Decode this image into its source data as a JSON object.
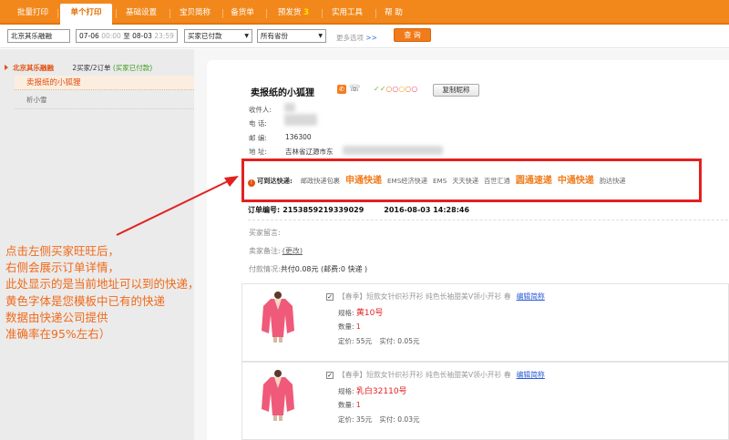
{
  "nav": {
    "tabs": [
      {
        "label": "批量打印"
      },
      {
        "label": "单个打印"
      },
      {
        "label": "基础设置"
      },
      {
        "label": "宝贝简称"
      },
      {
        "label": "备货单"
      },
      {
        "label": "预发货",
        "badge": "3"
      },
      {
        "label": "实用工具"
      },
      {
        "label": "帮 助"
      }
    ],
    "active_tab": "单个打印",
    "accent_color": "#f2881c"
  },
  "filter": {
    "shop": "北京其乐融融",
    "date_from": "07-06",
    "time_from": "00:00",
    "to_label": "至",
    "date_to": "08-03",
    "time_to": "23:59",
    "status": "买家已付款",
    "province": "所有省份",
    "more_options": "更多选项",
    "more_arrow": ">>",
    "query_button": "查 询"
  },
  "sidebar": {
    "shop_name": "北京其乐融融",
    "count": "2买家/2订单",
    "paid": "(买家已付款)",
    "buyers": [
      "卖报纸的小狐狸",
      "析小雪"
    ]
  },
  "detail": {
    "seller_name": "卖报纸的小狐狸",
    "credit_check": "✓✓",
    "copy_nick_button": "复制昵称",
    "receiver_label": "收件人:",
    "phone_label": "电  话:",
    "zip_label": "邮  编:",
    "zip": "136300",
    "address_label": "地  址:",
    "address": "吉林省辽源市东",
    "express": {
      "label": "可到达快递:",
      "items": [
        {
          "name": "邮政快递包裹",
          "highlight": false
        },
        {
          "name": "申通快递",
          "highlight": true
        },
        {
          "name": "EMS经济快递",
          "highlight": false
        },
        {
          "name": "EMS",
          "highlight": false
        },
        {
          "name": "天天快递",
          "highlight": false
        },
        {
          "name": "百世汇通",
          "highlight": false
        },
        {
          "name": "圆通速递",
          "highlight": true
        },
        {
          "name": "中通快递",
          "highlight": true
        },
        {
          "name": "韵达快递",
          "highlight": false
        }
      ]
    },
    "order_label": "订单编号:",
    "order_no": "2153859219339029",
    "order_time": "2016-08-03 14:28:46",
    "buyer_msg_label": "买家留言:",
    "seller_note_label": "卖家备注:",
    "seller_note_link": "(更改)",
    "pay_label": "付款情况:",
    "pay_value": "共付0.08元 (邮费:0 快递 )",
    "products": [
      {
        "title": "【春季】短款女针织衫开衫 纯色长袖甜美V领小开衫 春",
        "edit": "编辑简称",
        "spec_label": "规格:",
        "spec": "黄10号",
        "qty_label": "数量:",
        "qty": "1",
        "price_label": "定价:",
        "price": "55元",
        "paid_label": "实付:",
        "paid": "0.05元"
      },
      {
        "title": "【春季】短款女针织衫开衫 纯色长袖甜美V领小开衫 春",
        "edit": "编辑简称",
        "spec_label": "规格:",
        "spec": "乳白32110号",
        "qty_label": "数量:",
        "qty": "1",
        "price_label": "定价:",
        "price": "35元",
        "paid_label": "实付:",
        "paid": "0.03元"
      }
    ]
  },
  "annotation": [
    "点击左侧买家旺旺后，",
    "右侧会展示订单详情，",
    "此处显示的是当前地址可以到的快递，",
    "黄色字体是您模板中已有的快递",
    "数据由快递公司提供",
    "准确率在95%左右）"
  ],
  "colors": {
    "orange": "#f2881c",
    "highlight_express": "#f07b1a",
    "red_box": "#e32020",
    "annotation": "#f06a1a",
    "link_blue": "#2a5ad6"
  }
}
